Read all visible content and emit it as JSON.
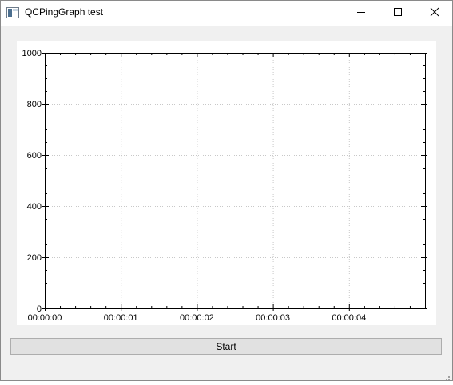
{
  "window": {
    "title": "QCPingGraph test",
    "icons": [
      "app-icon",
      "minimize-icon",
      "maximize-icon",
      "close-icon"
    ]
  },
  "chart_data": {
    "type": "line",
    "title": "",
    "xlabel": "",
    "ylabel": "",
    "x_tick_labels": [
      "00:00:00",
      "00:00:01",
      "00:00:02",
      "00:00:03",
      "00:00:04"
    ],
    "x_range": [
      0,
      5
    ],
    "y_tick_labels": [
      "0",
      "200",
      "400",
      "600",
      "800",
      "1000"
    ],
    "ylim": [
      0,
      1000
    ],
    "grid": true,
    "series": []
  },
  "controls": {
    "start_label": "Start"
  },
  "colors": {
    "grid": "#c8c8c8",
    "axis": "#000000",
    "button_bg": "#e1e1e1",
    "window_bg": "#f0f0f0"
  }
}
